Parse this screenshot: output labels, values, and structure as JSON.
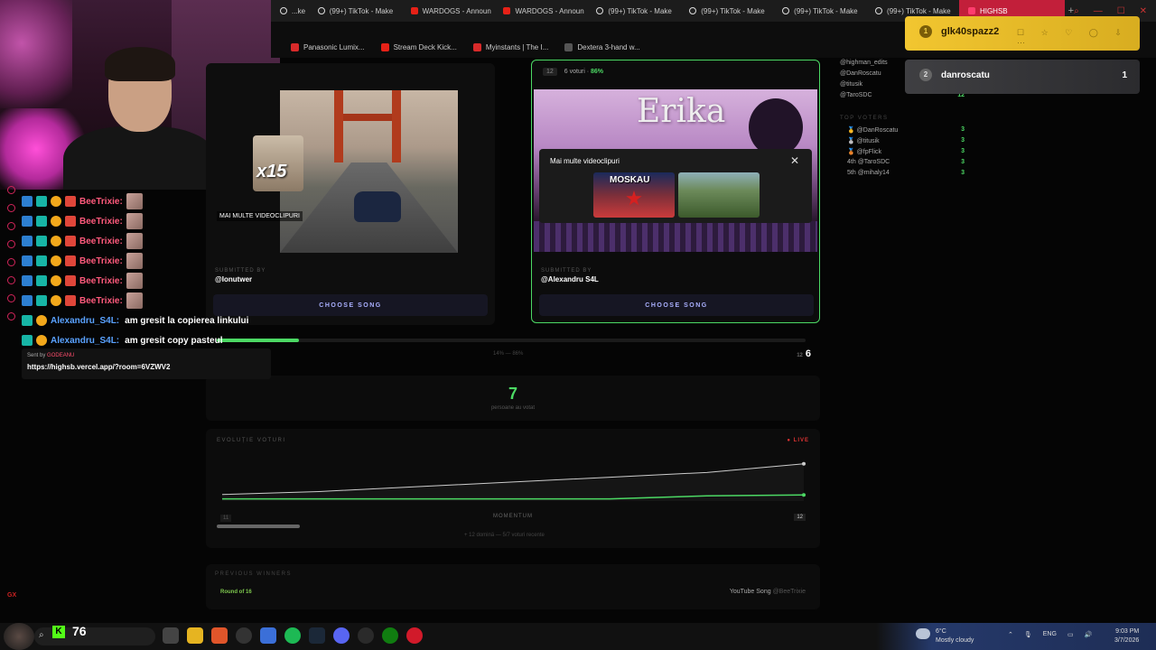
{
  "browser": {
    "tabs": [
      {
        "label": "...ke",
        "icon": "tiktok-icon"
      },
      {
        "label": "(99+) TikTok - Make",
        "icon": "tiktok-icon"
      },
      {
        "label": "WARDOGS - Announ",
        "icon": "youtube-icon"
      },
      {
        "label": "WARDOGS - Announ",
        "icon": "youtube-icon"
      },
      {
        "label": "(99+) TikTok - Make",
        "icon": "tiktok-icon"
      },
      {
        "label": "(99+) TikTok - Make",
        "icon": "tiktok-icon"
      },
      {
        "label": "(99+) TikTok - Make",
        "icon": "tiktok-icon"
      },
      {
        "label": "(99+) TikTok - Make",
        "icon": "tiktok-icon"
      },
      {
        "label": "HIGHSB",
        "icon": "highsb-icon",
        "active": true
      }
    ],
    "new_tab": "+",
    "bookmarks": [
      {
        "label": "Panasonic Lumix...",
        "icon": "red-favicon"
      },
      {
        "label": "Stream Deck Kick...",
        "icon": "youtube-icon"
      },
      {
        "label": "Myinstants | The I...",
        "icon": "red-favicon"
      },
      {
        "label": "Dextera 3-hand w...",
        "icon": "globe-icon"
      }
    ]
  },
  "chat": {
    "rows": [
      {
        "user": "BeeTrixie:",
        "text": ""
      },
      {
        "user": "BeeTrixie:",
        "text": ""
      },
      {
        "user": "BeeTrixie:",
        "text": ""
      },
      {
        "user": "BeeTrixie:",
        "text": ""
      },
      {
        "user": "BeeTrixie:",
        "text": ""
      },
      {
        "user": "BeeTrixie:",
        "text": ""
      },
      {
        "user": "Alexandru_S4L:",
        "text": "am gresit la copierea linkului"
      },
      {
        "user": "Alexandru_S4L:",
        "text": "am gresit copy pasteul"
      }
    ],
    "sent_by_label": "Sent by",
    "sent_by_user": "GODEANU",
    "sent_url": "https://highsb.vercel.app/?room=6VZWV2"
  },
  "left_card": {
    "more_label": "MAI MULTE VIDEOCLIPURI",
    "x15": "x15",
    "submitted_by_label": "SUBMITTED BY",
    "submitted_by": "@Ionutwer",
    "choose": "CHOOSE SONG"
  },
  "right_card": {
    "number": "12",
    "votes": "6 voturi ·",
    "percent": "86%",
    "thumb_title": "Erika",
    "popup_title": "Mai multe videoclipuri",
    "popup_close": "✕",
    "popup_thumb1": "MOSKAU",
    "popup_thumb2": "",
    "submitted_by_label": "SUBMITTED BY",
    "submitted_by": "@Alexandru S4L",
    "choose": "CHOOSE SONG"
  },
  "vote_bar": {
    "left_count": "1",
    "middle": "14% — 86%",
    "right_prefix": "12",
    "right_count": "6",
    "fill_fraction": 0.14
  },
  "total": {
    "count": "7",
    "label": "persoane au votat"
  },
  "evolution": {
    "title": "EVOLUȚIE VOTURI",
    "live": "● LIVE",
    "left_tag": "11",
    "momentum": "MOMENTUM",
    "right_tag": "12",
    "footer": "+ 12 dominä — 5/7 voturi recente",
    "scroll_fraction": 0.14
  },
  "chart_data": {
    "type": "line",
    "x": [
      1,
      2,
      3,
      4,
      5,
      6,
      7
    ],
    "series": [
      {
        "name": "",
        "values": [
          0.15,
          0.22,
          0.33,
          0.44,
          0.55,
          0.66,
          0.86
        ],
        "color": "#cccccc"
      },
      {
        "name": "",
        "values": [
          0.05,
          0.05,
          0.05,
          0.05,
          0.05,
          0.12,
          0.14
        ],
        "color": "#4cd964"
      }
    ],
    "ylim": [
      0,
      1
    ],
    "title": "",
    "xlabel": "",
    "ylabel": ""
  },
  "previous": {
    "title": "PREVIOUS WINNERS",
    "round": "Round of 16",
    "song": "YouTube Song",
    "by": "@BeeTrixie"
  },
  "sidebar": {
    "voters": [
      {
        "name": "@highman_edits",
        "count": ""
      },
      {
        "name": "@DanRoscatu",
        "count": ""
      },
      {
        "name": "@titusik",
        "count": "11"
      },
      {
        "name": "@TaroSDC",
        "count": "12"
      }
    ],
    "top_title": "TOP VOTERS",
    "top": [
      {
        "rank": "🥇",
        "name": "@DanRoscatu",
        "count": "3"
      },
      {
        "rank": "🥈",
        "name": "@titusik",
        "count": "3"
      },
      {
        "rank": "🥉",
        "name": "@fpFlick",
        "count": "3"
      },
      {
        "rank": "4th",
        "name": "@TaroSDC",
        "count": "3"
      },
      {
        "rank": "5th",
        "name": "@mihaly14",
        "count": "3"
      }
    ]
  },
  "notifications": [
    {
      "rank": "1",
      "name": "glk40spazz2",
      "score": ""
    },
    {
      "rank": "2",
      "name": "danroscatu",
      "score": "1"
    }
  ],
  "taskbar": {
    "kick_logo": "K",
    "kick_count": "76",
    "weather_temp": "6°C",
    "weather_desc": "Mostly cloudy",
    "lang": "ENG",
    "time": "9:03 PM",
    "date": "3/7/2026"
  },
  "overlay": {
    "gx": "GX"
  }
}
